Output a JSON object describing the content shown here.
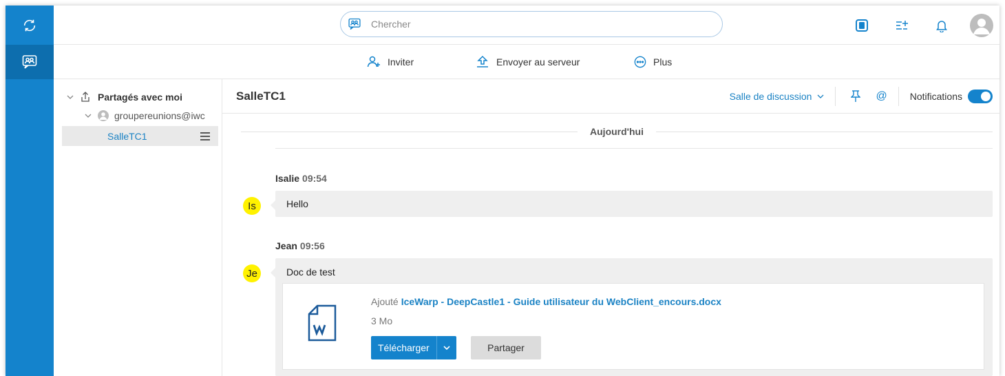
{
  "header": {
    "search_placeholder": "Chercher"
  },
  "actions": {
    "invite": "Inviter",
    "upload": "Envoyer au serveur",
    "more": "Plus"
  },
  "sidebar": {
    "root_label": "Partagés avec moi",
    "group_label": "groupereunions@iwc",
    "room_label": "SalleTC1"
  },
  "chat": {
    "title": "SalleTC1",
    "room_type": "Salle de discussion",
    "notifications_label": "Notifications",
    "notifications_on": true,
    "day_divider": "Aujourd'hui",
    "messages": [
      {
        "author": "Isalie",
        "time": "09:54",
        "initials": "Is",
        "text": "Hello"
      },
      {
        "author": "Jean",
        "time": "09:56",
        "initials": "Je",
        "text": "Doc de test",
        "attachment": {
          "prefix": "Ajouté",
          "filename": "IceWarp - DeepCastle1 - Guide utilisateur du WebClient_encours.docx",
          "size": "3 Mo",
          "download_label": "Télécharger",
          "share_label": "Partager"
        }
      }
    ]
  },
  "colors": {
    "brand": "#1483cc",
    "link": "#1a82c4",
    "avatar": "#fff200",
    "bubble": "#efefef"
  },
  "icons": {
    "rail": [
      "sync-icon",
      "chat-rooms-icon"
    ],
    "top": [
      "panel-icon",
      "list-add-icon",
      "bell-icon",
      "user-avatar-icon"
    ]
  }
}
